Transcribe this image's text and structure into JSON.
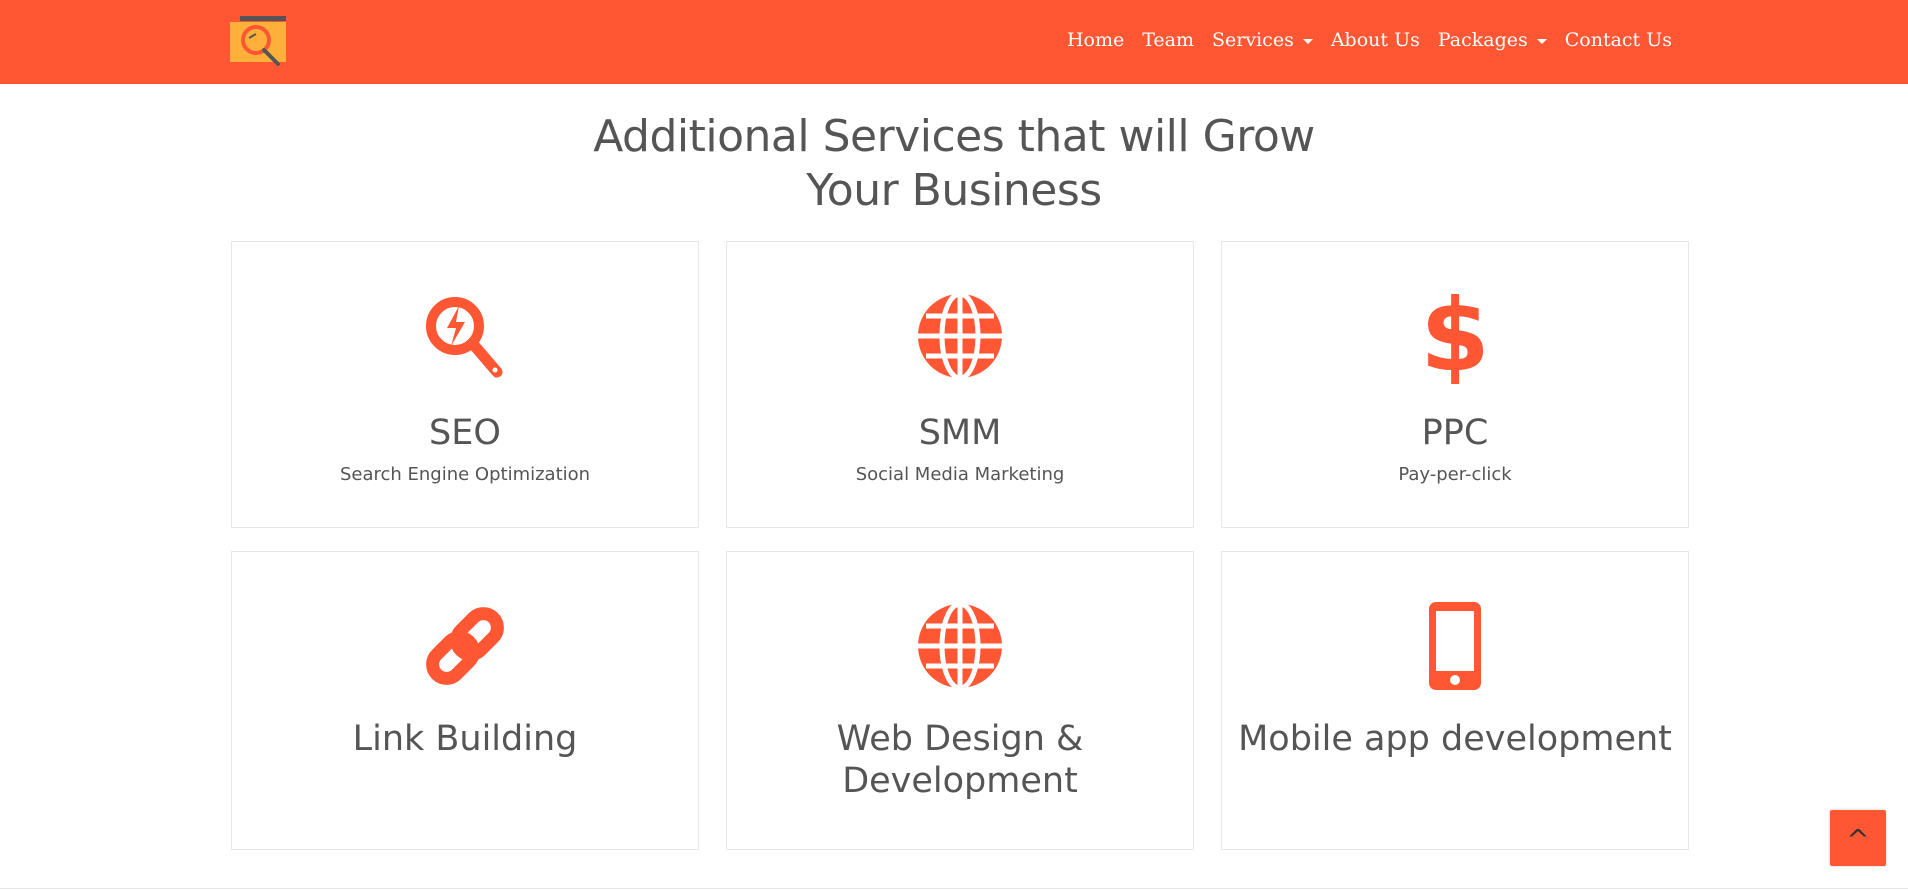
{
  "header": {
    "logo_icon": "seo-magnifier-logo",
    "nav": [
      {
        "label": "Home",
        "dropdown": false
      },
      {
        "label": "Team",
        "dropdown": false
      },
      {
        "label": "Services",
        "dropdown": true
      },
      {
        "label": "About Us",
        "dropdown": false
      },
      {
        "label": "Packages",
        "dropdown": true
      },
      {
        "label": "Contact Us",
        "dropdown": false
      }
    ]
  },
  "main": {
    "heading_line1": "Additional Services that will Grow",
    "heading_line2": "Your Business",
    "services": [
      {
        "icon": "seo-search-bolt-icon",
        "title": "SEO",
        "subtitle": "Search Engine Optimization"
      },
      {
        "icon": "globe-icon",
        "title": "SMM",
        "subtitle": "Social Media Marketing"
      },
      {
        "icon": "dollar-icon",
        "title": "PPC",
        "subtitle": "Pay-per-click"
      },
      {
        "icon": "link-icon",
        "title_line1": "Link Building"
      },
      {
        "icon": "globe-icon",
        "title_line1": "Web Design &",
        "title_line2": "Development"
      },
      {
        "icon": "mobile-phone-icon",
        "title_line1": "Mobile app development"
      }
    ]
  },
  "back_to_top": {
    "label": "^"
  },
  "colors": {
    "brand": "#ff5733",
    "text": "#555555",
    "nav_text": "#ffffff"
  }
}
